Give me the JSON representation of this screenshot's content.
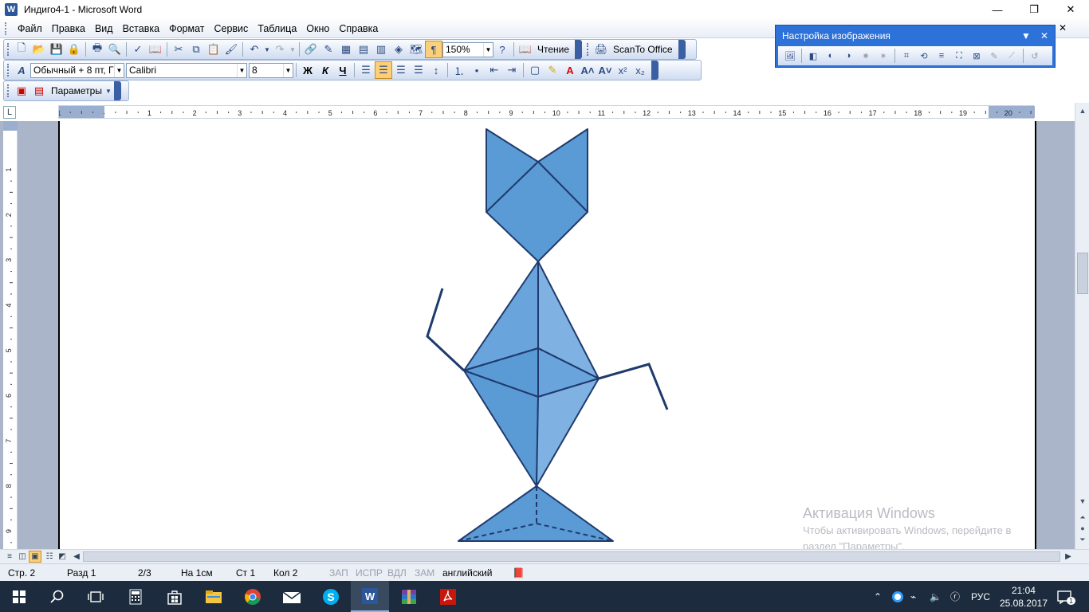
{
  "window": {
    "title": "Индиго4-1 - Microsoft Word",
    "controls": {
      "minimize": "—",
      "maximize": "❐",
      "close": "✕"
    }
  },
  "menu": {
    "items": [
      "Файл",
      "Правка",
      "Вид",
      "Вставка",
      "Формат",
      "Сервис",
      "Таблица",
      "Окно",
      "Справка"
    ],
    "doc_close": "✕"
  },
  "standard_toolbar": {
    "zoom": "150%",
    "reading_label": "Чтение",
    "scanto_label": "ScanTo Office"
  },
  "formatting_toolbar": {
    "style": "Обычный + 8 пт, Г",
    "font": "Calibri",
    "size": "8",
    "bold": "Ж",
    "italic": "К",
    "underline": "Ч"
  },
  "extra_toolbar": {
    "params_label": "Параметры"
  },
  "picture_toolbar": {
    "title": "Настройка изображения",
    "dropdown": "▼",
    "close": "✕"
  },
  "ruler": {
    "corner": "L",
    "labels": [
      "1",
      "·",
      "1",
      "2",
      "3",
      "4",
      "5",
      "6",
      "7",
      "8",
      "9",
      "10",
      "11",
      "12",
      "13",
      "14",
      "15",
      "16",
      "17",
      "18",
      "19",
      "20"
    ],
    "vlabels": [
      "1",
      "2",
      "3",
      "4",
      "5",
      "6",
      "7",
      "8",
      "9"
    ]
  },
  "activation": {
    "title": "Активация Windows",
    "line1": "Чтобы активировать Windows, перейдите в",
    "line2": "раздел \"Параметры\"."
  },
  "status": {
    "page": "Стр. 2",
    "section": "Разд 1",
    "pages": "2/3",
    "at": "На 1см",
    "line": "Ст 1",
    "col": "Кол 2",
    "rec": "ЗАП",
    "trk": "ИСПР",
    "ext": "ВДЛ",
    "ovr": "ЗАМ",
    "language": "английский"
  },
  "taskbar": {
    "language": "РУС",
    "time": "21:04",
    "date": "25.08.2017",
    "notification_count": "1"
  },
  "colors": {
    "shape_fill": "#5b9bd5",
    "shape_stroke": "#1f3b6e",
    "page_bg": "#ffffff",
    "workspace": "#abb5c9",
    "taskbar": "#1c2b3d",
    "picture_toolbar": "#2d72d9"
  }
}
